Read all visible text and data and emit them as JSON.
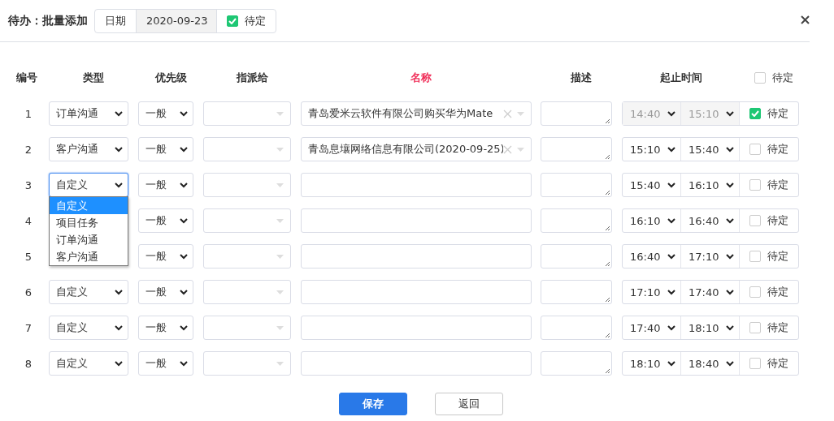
{
  "header": {
    "title": "待办：批量添加",
    "date_label": "日期",
    "date": "2020-09-23",
    "pending": {
      "label": "待定",
      "checked": true
    }
  },
  "columns": [
    {
      "label": "编号",
      "required": false
    },
    {
      "label": "类型",
      "required": false
    },
    {
      "label": "优先级",
      "required": false
    },
    {
      "label": "指派给",
      "required": false
    },
    {
      "label": "名称",
      "required": true
    },
    {
      "label": "描述",
      "required": false
    },
    {
      "label": "起止时间",
      "required": false
    }
  ],
  "header_pending": {
    "label": "待定",
    "checked": false
  },
  "rows": [
    {
      "number": "1",
      "type": "订单沟通",
      "priority": "一般",
      "name": "青岛爱米云软件有限公司购买华为Mate",
      "start": "14:40",
      "end": "15:10",
      "disabled": true,
      "pending": {
        "label": "待定",
        "checked": true
      }
    },
    {
      "number": "2",
      "type": "客户沟通",
      "priority": "一般",
      "name": "青岛息壤网络信息有限公司(2020-09-25)",
      "start": "15:10",
      "end": "15:40",
      "disabled": false,
      "pending": {
        "label": "待定",
        "checked": false
      }
    },
    {
      "number": "3",
      "type": "自定义",
      "priority": "一般",
      "start": "15:40",
      "end": "16:10",
      "disabled": false,
      "pending": {
        "label": "待定",
        "checked": false
      },
      "open_menu": [
        {
          "label": "自定义",
          "selected": true
        },
        {
          "label": "项目任务",
          "selected": false
        },
        {
          "label": "订单沟通",
          "selected": false
        },
        {
          "label": "客户沟通",
          "selected": false
        }
      ]
    },
    {
      "number": "4",
      "priority": "一般",
      "start": "16:10",
      "end": "16:40",
      "disabled": false,
      "pending": {
        "label": "待定",
        "checked": false
      }
    },
    {
      "number": "5",
      "priority": "一般",
      "start": "16:40",
      "end": "17:10",
      "disabled": false,
      "pending": {
        "label": "待定",
        "checked": false
      }
    },
    {
      "number": "6",
      "type": "自定义",
      "priority": "一般",
      "start": "17:10",
      "end": "17:40",
      "disabled": false,
      "pending": {
        "label": "待定",
        "checked": false
      }
    },
    {
      "number": "7",
      "type": "自定义",
      "priority": "一般",
      "start": "17:40",
      "end": "18:10",
      "disabled": false,
      "pending": {
        "label": "待定",
        "checked": false
      }
    },
    {
      "number": "8",
      "type": "自定义",
      "priority": "一般",
      "start": "18:10",
      "end": "18:40",
      "disabled": false,
      "pending": {
        "label": "待定",
        "checked": false
      }
    }
  ],
  "buttons": [
    {
      "label": "保存",
      "kind": "primary"
    },
    {
      "label": "返回",
      "kind": "default"
    }
  ]
}
